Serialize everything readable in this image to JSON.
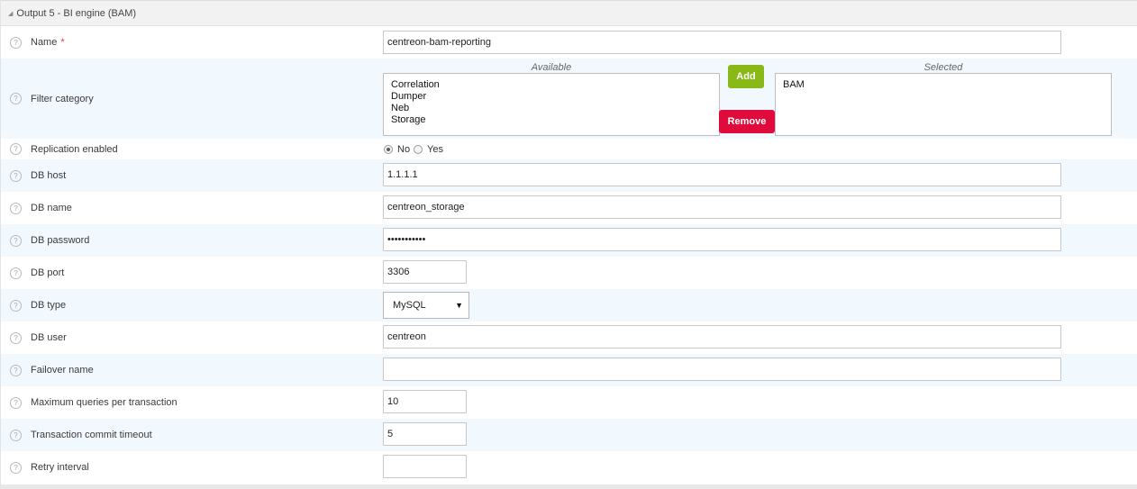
{
  "section": {
    "title": "Output 5 - BI engine (BAM)"
  },
  "help_glyph": "?",
  "fields": {
    "name": {
      "label": "Name",
      "required_mark": "*",
      "value": "centreon-bam-reporting"
    },
    "filter_category": {
      "label": "Filter category",
      "available_caption": "Available",
      "selected_caption": "Selected",
      "available": [
        "Correlation",
        "Dumper",
        "Neb",
        "Storage"
      ],
      "selected": [
        "BAM"
      ],
      "add_label": "Add",
      "remove_label": "Remove"
    },
    "replication": {
      "label": "Replication enabled",
      "options": [
        "No",
        "Yes"
      ],
      "selected": "No"
    },
    "db_host": {
      "label": "DB host",
      "value": "1.1.1.1"
    },
    "db_name": {
      "label": "DB name",
      "value": "centreon_storage"
    },
    "db_password": {
      "label": "DB password",
      "value": "•••••••••••"
    },
    "db_port": {
      "label": "DB port",
      "value": "3306"
    },
    "db_type": {
      "label": "DB type",
      "value": "MySQL"
    },
    "db_user": {
      "label": "DB user",
      "value": "centreon"
    },
    "failover_name": {
      "label": "Failover name",
      "value": ""
    },
    "max_queries": {
      "label": "Maximum queries per transaction",
      "value": "10"
    },
    "commit_timeout": {
      "label": "Transaction commit timeout",
      "value": "5"
    },
    "retry_interval": {
      "label": "Retry interval",
      "value": ""
    }
  },
  "colors": {
    "add": "#88b917",
    "remove": "#e00b3d",
    "alt_row": "#f2f9fe",
    "required": "#e03c31"
  },
  "icons": {
    "help": "help-circle-icon",
    "collapse": "collapse-triangle-icon",
    "dropdown": "dropdown-arrow-icon"
  }
}
